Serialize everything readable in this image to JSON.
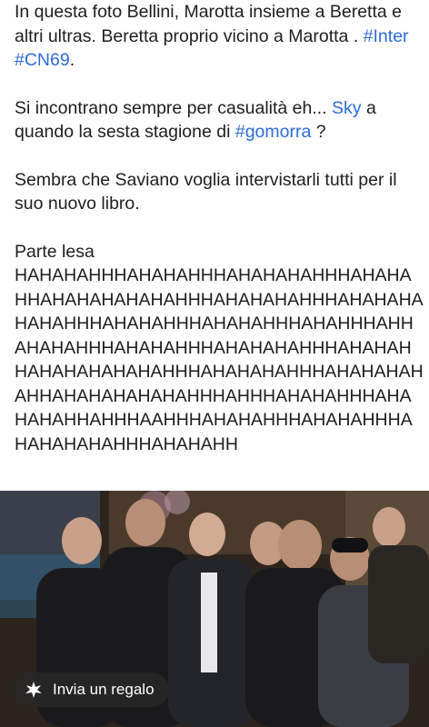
{
  "post": {
    "p1_a": "In questa foto Bellini, Marotta insieme a Beretta e altri ultras. Beretta proprio vicino a Marotta . ",
    "p1_tag1": "#Inter",
    "p1_tag2": "#CN69",
    "p1_end": ".",
    "p2_a": "Si incontrano sempre per casualità eh... ",
    "p2_link": "Sky",
    "p2_b": " a quando la sesta stagione di ",
    "p2_tag": "#gomorra",
    "p2_end": " ?",
    "p3": "Sembra che Saviano voglia intervistarli tutti per il suo nuovo libro.",
    "p4_title": "Parte lesa",
    "p4_laugh": "HAHAHAHHHAHAHAHHHAHAHAHAHHHAHAHAHHAHAHAHAHAHAHHHAHAHAHAHHHAHAHAHAHAHAHHHAHAHAHHHAHAHAHHHAHAHHHAHHAHAHAHHHAHAHAHHHAHAHAHAHHHAHAHAHHAHAHAHAHAHAHHHAHAHAHAHHHAHAHAHAHAHHAHAHAHAHAHAHHHAHHHAHAHAHHHAHAHAHAHHAHHHAAHHHAHAHAHHHAHAHAHHHAHAHAHAHAHHHAHAHAHH"
  },
  "photo": {
    "alt": ""
  },
  "gift": {
    "label": "Invia un regalo",
    "icon": "gift-icon"
  },
  "colors": {
    "link": "#2d6bd8",
    "text": "#1c1e21"
  }
}
